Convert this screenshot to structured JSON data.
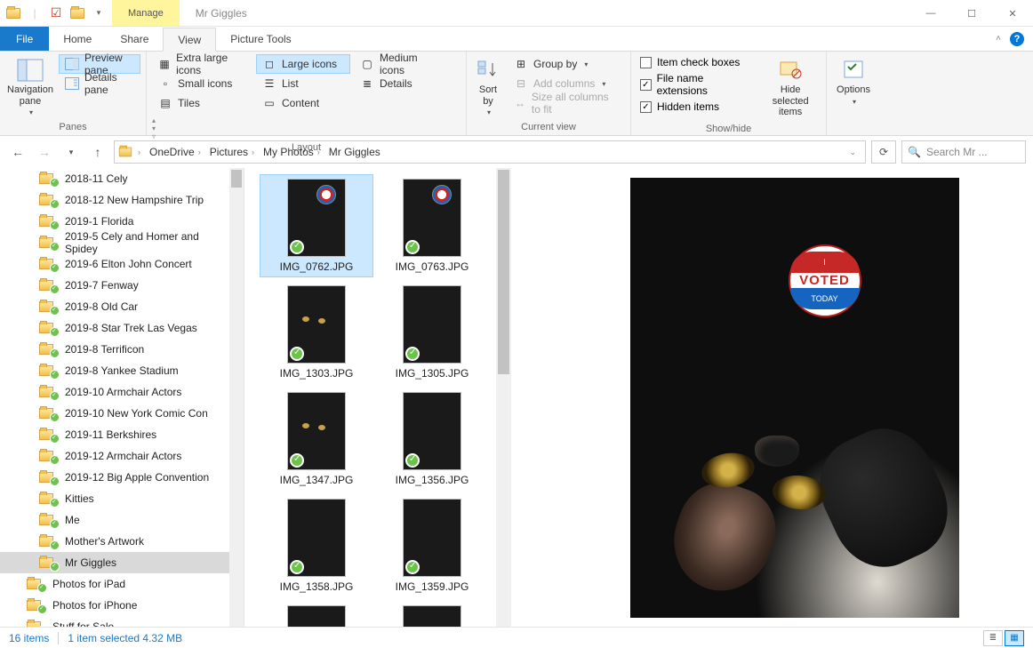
{
  "title": "Mr Giggles",
  "context_tab": {
    "top": "Manage",
    "bottom": "Picture Tools"
  },
  "tabs": {
    "file": "File",
    "home": "Home",
    "share": "Share",
    "view": "View"
  },
  "ribbon": {
    "panes": {
      "label": "Panes",
      "nav": "Navigation pane",
      "preview": "Preview pane",
      "details": "Details pane"
    },
    "layout": {
      "label": "Layout",
      "xl": "Extra large icons",
      "lg": "Large icons",
      "md": "Medium icons",
      "sm": "Small icons",
      "list": "List",
      "det": "Details",
      "tiles": "Tiles",
      "content": "Content"
    },
    "currentview": {
      "label": "Current view",
      "sort": "Sort by",
      "group": "Group by",
      "addcols": "Add columns",
      "sizecols": "Size all columns to fit"
    },
    "showhide": {
      "label": "Show/hide",
      "itemcb": "Item check boxes",
      "ext": "File name extensions",
      "hidden": "Hidden items",
      "hidesel": "Hide selected items"
    },
    "options": "Options"
  },
  "breadcrumb": [
    "OneDrive",
    "Pictures",
    "My Photos",
    "Mr Giggles"
  ],
  "search_placeholder": "Search Mr ...",
  "tree": [
    {
      "label": "2018-11 Cely",
      "level": 1
    },
    {
      "label": "2018-12 New Hampshire Trip",
      "level": 1
    },
    {
      "label": "2019-1 Florida",
      "level": 1
    },
    {
      "label": "2019-5 Cely and Homer and Spidey",
      "level": 1
    },
    {
      "label": "2019-6 Elton John Concert",
      "level": 1
    },
    {
      "label": "2019-7 Fenway",
      "level": 1
    },
    {
      "label": "2019-8 Old Car",
      "level": 1
    },
    {
      "label": "2019-8 Star Trek Las Vegas",
      "level": 1
    },
    {
      "label": "2019-8 Terrificon",
      "level": 1
    },
    {
      "label": "2019-8 Yankee Stadium",
      "level": 1
    },
    {
      "label": "2019-10 Armchair Actors",
      "level": 1
    },
    {
      "label": "2019-10 New York Comic Con",
      "level": 1
    },
    {
      "label": "2019-11 Berkshires",
      "level": 1
    },
    {
      "label": "2019-12 Armchair Actors",
      "level": 1
    },
    {
      "label": "2019-12 Big Apple Convention",
      "level": 1
    },
    {
      "label": "Kitties",
      "level": 1
    },
    {
      "label": "Me",
      "level": 1
    },
    {
      "label": "Mother's Artwork",
      "level": 1
    },
    {
      "label": "Mr Giggles",
      "level": 1,
      "selected": true
    },
    {
      "label": "Photos for iPad",
      "level": 2
    },
    {
      "label": "Photos for iPhone",
      "level": 2
    },
    {
      "label": "Stuff for Sale",
      "level": 2
    }
  ],
  "files": [
    {
      "name": "IMG_0762.JPG",
      "selected": true,
      "voted": true
    },
    {
      "name": "IMG_0763.JPG",
      "voted": true
    },
    {
      "name": "IMG_1303.JPG",
      "eyes": true
    },
    {
      "name": "IMG_1305.JPG"
    },
    {
      "name": "IMG_1347.JPG",
      "eyes": true
    },
    {
      "name": "IMG_1356.JPG"
    },
    {
      "name": "IMG_1358.JPG"
    },
    {
      "name": "IMG_1359.JPG"
    }
  ],
  "sticker": {
    "top": "I",
    "mid": "VOTED",
    "bot": "TODAY"
  },
  "status": {
    "count": "16 items",
    "sel": "1 item selected  4.32 MB"
  }
}
